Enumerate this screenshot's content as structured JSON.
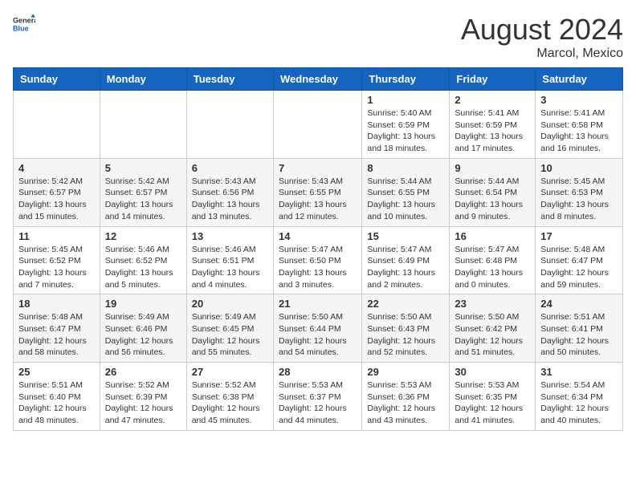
{
  "header": {
    "logo_general": "General",
    "logo_blue": "Blue",
    "month_year": "August 2024",
    "location": "Marcol, Mexico"
  },
  "days_of_week": [
    "Sunday",
    "Monday",
    "Tuesday",
    "Wednesday",
    "Thursday",
    "Friday",
    "Saturday"
  ],
  "weeks": [
    [
      {
        "day": "",
        "info": ""
      },
      {
        "day": "",
        "info": ""
      },
      {
        "day": "",
        "info": ""
      },
      {
        "day": "",
        "info": ""
      },
      {
        "day": "1",
        "info": "Sunrise: 5:40 AM\nSunset: 6:59 PM\nDaylight: 13 hours\nand 18 minutes."
      },
      {
        "day": "2",
        "info": "Sunrise: 5:41 AM\nSunset: 6:59 PM\nDaylight: 13 hours\nand 17 minutes."
      },
      {
        "day": "3",
        "info": "Sunrise: 5:41 AM\nSunset: 6:58 PM\nDaylight: 13 hours\nand 16 minutes."
      }
    ],
    [
      {
        "day": "4",
        "info": "Sunrise: 5:42 AM\nSunset: 6:57 PM\nDaylight: 13 hours\nand 15 minutes."
      },
      {
        "day": "5",
        "info": "Sunrise: 5:42 AM\nSunset: 6:57 PM\nDaylight: 13 hours\nand 14 minutes."
      },
      {
        "day": "6",
        "info": "Sunrise: 5:43 AM\nSunset: 6:56 PM\nDaylight: 13 hours\nand 13 minutes."
      },
      {
        "day": "7",
        "info": "Sunrise: 5:43 AM\nSunset: 6:55 PM\nDaylight: 13 hours\nand 12 minutes."
      },
      {
        "day": "8",
        "info": "Sunrise: 5:44 AM\nSunset: 6:55 PM\nDaylight: 13 hours\nand 10 minutes."
      },
      {
        "day": "9",
        "info": "Sunrise: 5:44 AM\nSunset: 6:54 PM\nDaylight: 13 hours\nand 9 minutes."
      },
      {
        "day": "10",
        "info": "Sunrise: 5:45 AM\nSunset: 6:53 PM\nDaylight: 13 hours\nand 8 minutes."
      }
    ],
    [
      {
        "day": "11",
        "info": "Sunrise: 5:45 AM\nSunset: 6:52 PM\nDaylight: 13 hours\nand 7 minutes."
      },
      {
        "day": "12",
        "info": "Sunrise: 5:46 AM\nSunset: 6:52 PM\nDaylight: 13 hours\nand 5 minutes."
      },
      {
        "day": "13",
        "info": "Sunrise: 5:46 AM\nSunset: 6:51 PM\nDaylight: 13 hours\nand 4 minutes."
      },
      {
        "day": "14",
        "info": "Sunrise: 5:47 AM\nSunset: 6:50 PM\nDaylight: 13 hours\nand 3 minutes."
      },
      {
        "day": "15",
        "info": "Sunrise: 5:47 AM\nSunset: 6:49 PM\nDaylight: 13 hours\nand 2 minutes."
      },
      {
        "day": "16",
        "info": "Sunrise: 5:47 AM\nSunset: 6:48 PM\nDaylight: 13 hours\nand 0 minutes."
      },
      {
        "day": "17",
        "info": "Sunrise: 5:48 AM\nSunset: 6:47 PM\nDaylight: 12 hours\nand 59 minutes."
      }
    ],
    [
      {
        "day": "18",
        "info": "Sunrise: 5:48 AM\nSunset: 6:47 PM\nDaylight: 12 hours\nand 58 minutes."
      },
      {
        "day": "19",
        "info": "Sunrise: 5:49 AM\nSunset: 6:46 PM\nDaylight: 12 hours\nand 56 minutes."
      },
      {
        "day": "20",
        "info": "Sunrise: 5:49 AM\nSunset: 6:45 PM\nDaylight: 12 hours\nand 55 minutes."
      },
      {
        "day": "21",
        "info": "Sunrise: 5:50 AM\nSunset: 6:44 PM\nDaylight: 12 hours\nand 54 minutes."
      },
      {
        "day": "22",
        "info": "Sunrise: 5:50 AM\nSunset: 6:43 PM\nDaylight: 12 hours\nand 52 minutes."
      },
      {
        "day": "23",
        "info": "Sunrise: 5:50 AM\nSunset: 6:42 PM\nDaylight: 12 hours\nand 51 minutes."
      },
      {
        "day": "24",
        "info": "Sunrise: 5:51 AM\nSunset: 6:41 PM\nDaylight: 12 hours\nand 50 minutes."
      }
    ],
    [
      {
        "day": "25",
        "info": "Sunrise: 5:51 AM\nSunset: 6:40 PM\nDaylight: 12 hours\nand 48 minutes."
      },
      {
        "day": "26",
        "info": "Sunrise: 5:52 AM\nSunset: 6:39 PM\nDaylight: 12 hours\nand 47 minutes."
      },
      {
        "day": "27",
        "info": "Sunrise: 5:52 AM\nSunset: 6:38 PM\nDaylight: 12 hours\nand 45 minutes."
      },
      {
        "day": "28",
        "info": "Sunrise: 5:53 AM\nSunset: 6:37 PM\nDaylight: 12 hours\nand 44 minutes."
      },
      {
        "day": "29",
        "info": "Sunrise: 5:53 AM\nSunset: 6:36 PM\nDaylight: 12 hours\nand 43 minutes."
      },
      {
        "day": "30",
        "info": "Sunrise: 5:53 AM\nSunset: 6:35 PM\nDaylight: 12 hours\nand 41 minutes."
      },
      {
        "day": "31",
        "info": "Sunrise: 5:54 AM\nSunset: 6:34 PM\nDaylight: 12 hours\nand 40 minutes."
      }
    ]
  ]
}
